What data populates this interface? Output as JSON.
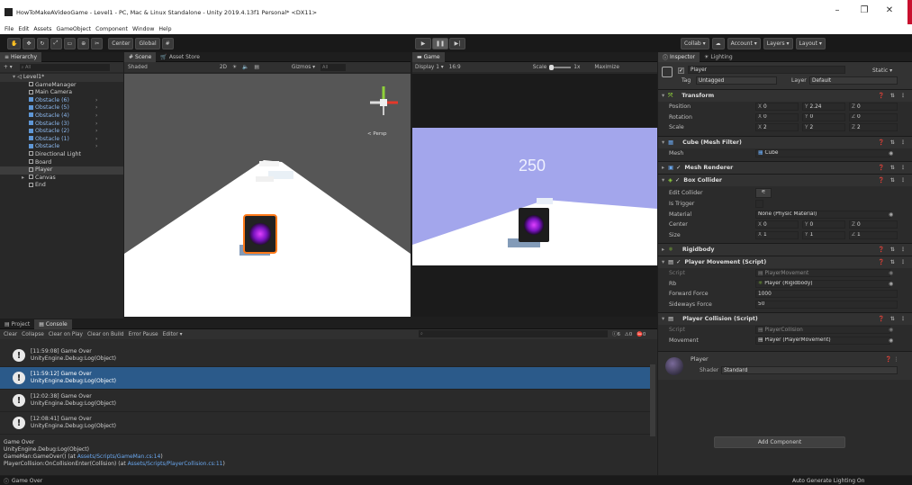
{
  "window": {
    "title": "HowToMakeAVideoGame - Level1 - PC, Mac & Linux Standalone - Unity 2019.4.13f1 Personal* <DX11>",
    "minimize_icon": "minimize-icon",
    "maximize_icon": "maximize-icon",
    "close_icon": "close-icon"
  },
  "menu": [
    "File",
    "Edit",
    "Assets",
    "GameObject",
    "Component",
    "Window",
    "Help"
  ],
  "toolbar": {
    "center_label": "Center",
    "global_label": "Global",
    "collab_label": "Collab ▾",
    "account_label": "Account ▾",
    "layers_label": "Layers ▾",
    "layout_label": "Layout ▾"
  },
  "hierarchy": {
    "tab": "Hierarchy",
    "search_placeholder": "All",
    "scene": "Level1*",
    "items": [
      {
        "name": "GameManager",
        "prefab": false
      },
      {
        "name": "Main Camera",
        "prefab": false
      },
      {
        "name": "Obstacle (6)",
        "prefab": true
      },
      {
        "name": "Obstacle (5)",
        "prefab": true
      },
      {
        "name": "Obstacle (4)",
        "prefab": true
      },
      {
        "name": "Obstacle (3)",
        "prefab": true
      },
      {
        "name": "Obstacle (2)",
        "prefab": true
      },
      {
        "name": "Obstacle (1)",
        "prefab": true
      },
      {
        "name": "Obstacle",
        "prefab": true
      },
      {
        "name": "Directional Light",
        "prefab": false
      },
      {
        "name": "Board",
        "prefab": false
      },
      {
        "name": "Player",
        "prefab": false
      },
      {
        "name": "Canvas",
        "prefab": false
      },
      {
        "name": "End",
        "prefab": false
      }
    ]
  },
  "scene": {
    "tab": "Scene",
    "asset_store_tab": "Asset Store",
    "shading": "Shaded",
    "mode_2d": "2D",
    "gizmos": "Gizmos ▾",
    "search_placeholder": "All",
    "persp": "< Persp"
  },
  "game": {
    "tab": "Game",
    "display": "Display 1 ▾",
    "aspect": "16:9",
    "scale_label": "Scale",
    "scale_value": "1x",
    "maximize": "Maximize",
    "score": "250"
  },
  "console": {
    "project_tab": "Project",
    "console_tab": "Console",
    "clear": "Clear",
    "collapse": "Collapse",
    "clear_on_play": "Clear on Play",
    "clear_on_build": "Clear on Build",
    "error_pause": "Error Pause",
    "editor": "Editor ▾",
    "count_messages": "6",
    "count_warnings": "0",
    "count_errors": "0",
    "entries": [
      {
        "time": "[11:59:08] Game Over",
        "source": "UnityEngine.Debug:Log(Object)"
      },
      {
        "time": "[11:59:12] Game Over",
        "source": "UnityEngine.Debug:Log(Object)"
      },
      {
        "time": "[12:02:38] Game Over",
        "source": "UnityEngine.Debug:Log(Object)"
      },
      {
        "time": "[12:08:41] Game Over",
        "source": "UnityEngine.Debug:Log(Object)"
      }
    ],
    "detail": {
      "line1": "Game Over",
      "line2": "UnityEngine.Debug:Log(Object)",
      "line3_prefix": "GameMan:GameOver() (at ",
      "line3_link": "Assets/Scripts/GameMan.cs:14",
      "line3_suffix": ")",
      "line4_prefix": "PlayerCollision:OnCollisionEnter(Collision) (at ",
      "line4_link": "Assets/Scripts/PlayerCollision.cs:11",
      "line4_suffix": ")"
    }
  },
  "inspector": {
    "tab": "Inspector",
    "lighting_tab": "Lighting",
    "object_name": "Player",
    "static": "Static ▾",
    "tag_label": "Tag",
    "tag_value": "Untagged",
    "layer_label": "Layer",
    "layer_value": "Default",
    "transform": {
      "title": "Transform",
      "position_label": "Position",
      "position": [
        "0",
        "2.24",
        "0"
      ],
      "rotation_label": "Rotation",
      "rotation": [
        "0",
        "0",
        "0"
      ],
      "scale_label": "Scale",
      "scale": [
        "2",
        "2",
        "2"
      ]
    },
    "mesh_filter": {
      "title": "Cube (Mesh Filter)",
      "mesh_label": "Mesh",
      "mesh_value": "Cube"
    },
    "mesh_renderer": {
      "title": "Mesh Renderer"
    },
    "box_collider": {
      "title": "Box Collider",
      "edit_label": "Edit Collider",
      "trigger_label": "Is Trigger",
      "material_label": "Material",
      "material_value": "None (Physic Material)",
      "center_label": "Center",
      "center": [
        "0",
        "0",
        "0"
      ],
      "size_label": "Size",
      "size": [
        "1",
        "1",
        "1"
      ]
    },
    "rigidbody": {
      "title": "Rigidbody"
    },
    "player_movement": {
      "title": "Player Movement (Script)",
      "script_label": "Script",
      "script_value": "PlayerMovement",
      "rb_label": "Rb",
      "rb_value": "Player (Rigidbody)",
      "forward_label": "Forward Force",
      "forward_value": "1000",
      "sideways_label": "Sideways Force",
      "sideways_value": "50"
    },
    "player_collision": {
      "title": "Player Collision (Script)",
      "script_label": "Script",
      "script_value": "PlayerCollision",
      "movement_label": "Movement",
      "movement_value": "Player (PlayerMovement)"
    },
    "material": {
      "name": "Player",
      "shader_label": "Shader",
      "shader_value": "Standard"
    },
    "add_component": "Add Component"
  },
  "status": {
    "message": "Game Over",
    "right": "Auto Generate Lighting On"
  },
  "colors": {
    "accent": "#2b5a8a",
    "prefab": "#8cb8ee",
    "cube": "#8a2be2",
    "skybox": "#a3a6ec"
  }
}
